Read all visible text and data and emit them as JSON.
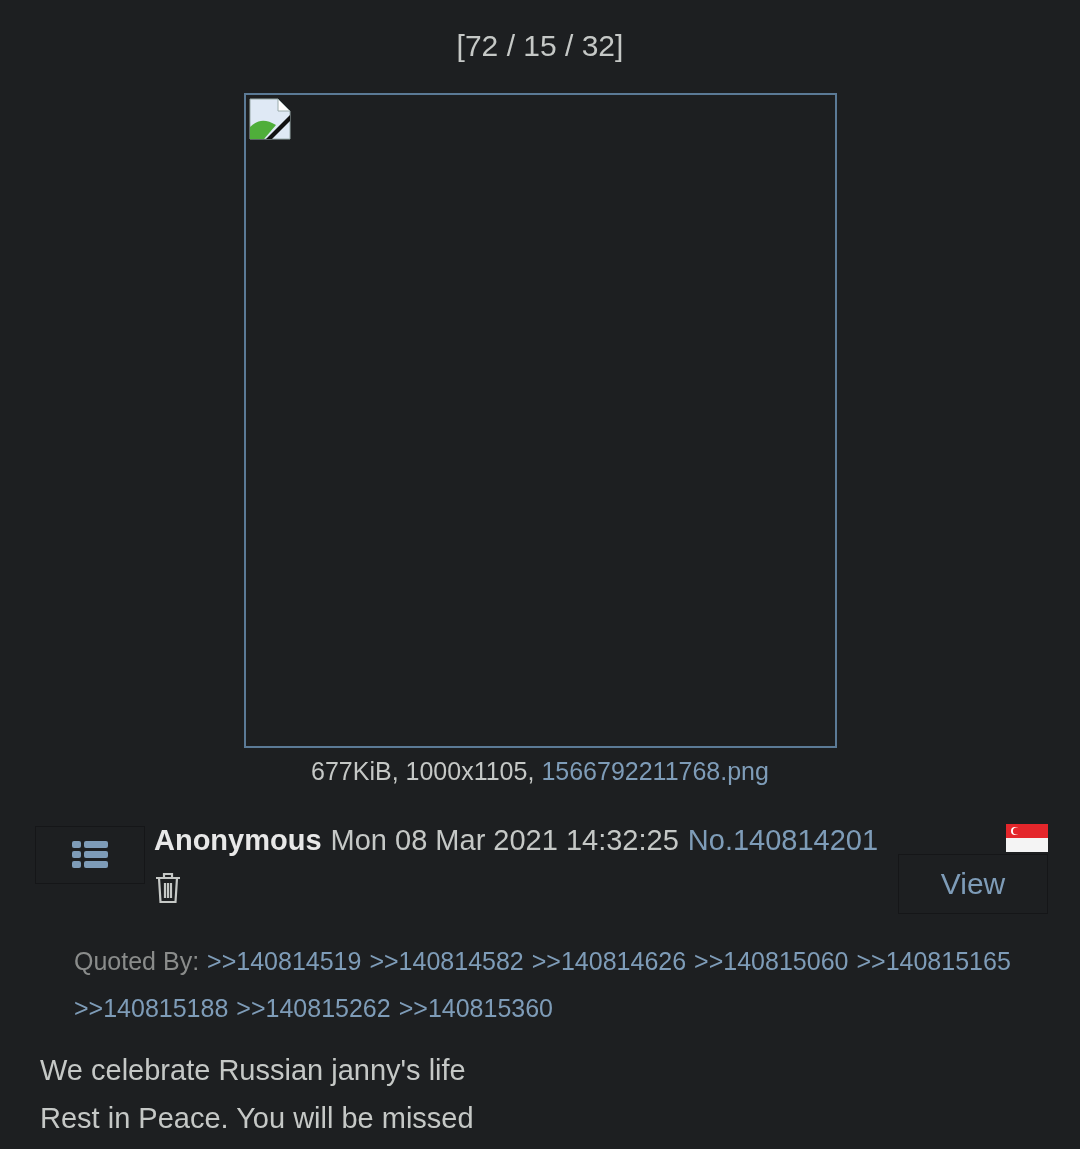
{
  "counter": "[72 / 15 / 32]",
  "file": {
    "info": "677KiB, 1000x1105,",
    "filename": "1566792211768.png"
  },
  "post": {
    "name": "Anonymous",
    "date": "Mon 08 Mar 2021 14:32:25",
    "number": "No.140814201",
    "view_button": "View"
  },
  "quoted_by": {
    "label": "Quoted By:",
    "links": [
      ">>140814519",
      ">>140814582",
      ">>140814626",
      ">>140815060",
      ">>140815165",
      ">>140815188",
      ">>140815262",
      ">>140815360"
    ]
  },
  "message": [
    "We celebrate Russian janny's life",
    "Rest in Peace. You will be missed"
  ]
}
